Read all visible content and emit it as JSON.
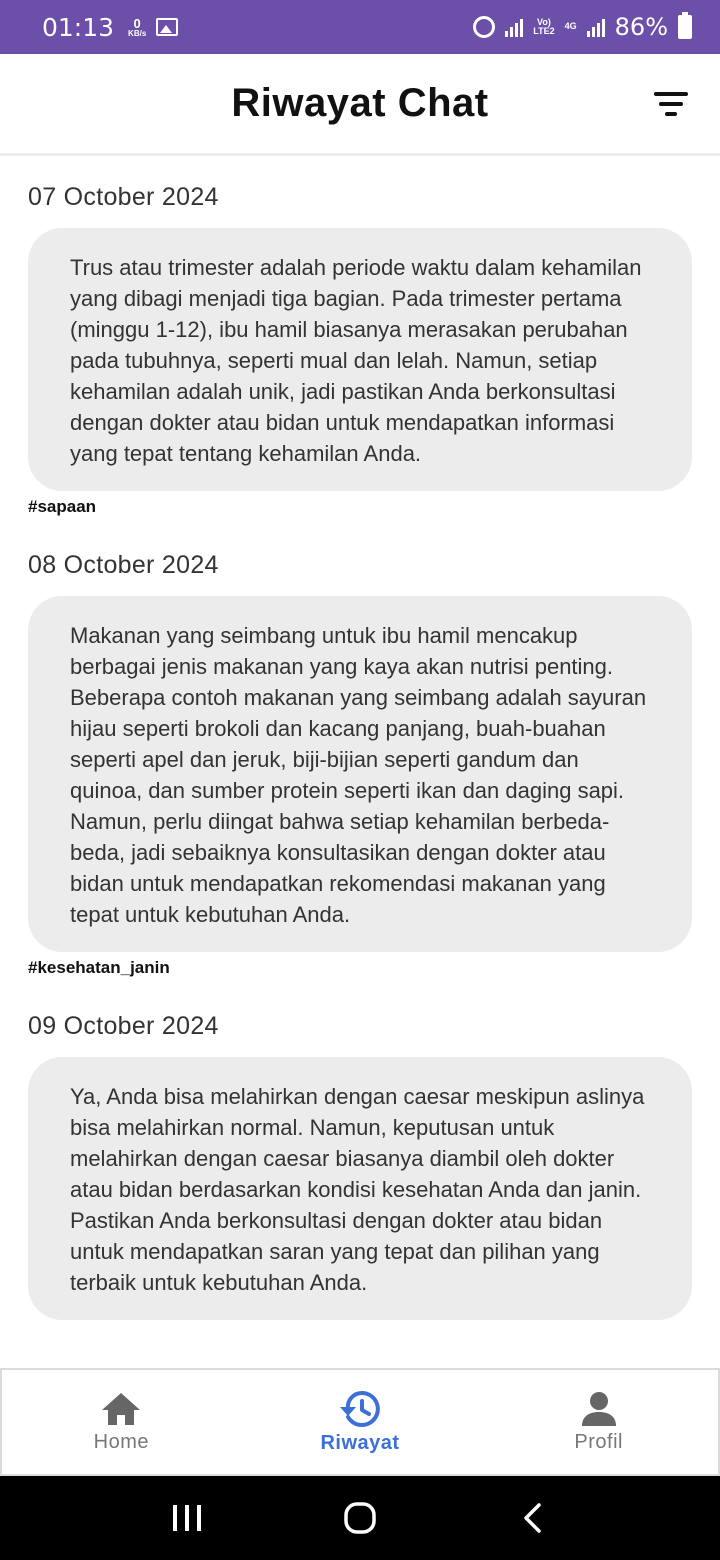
{
  "status_bar": {
    "time": "01:13",
    "speed_value": "0",
    "speed_unit": "KB/s",
    "network_top": "Vo)",
    "network_bottom": "LTE2",
    "network_gen": "4G",
    "battery": "86%"
  },
  "header": {
    "title": "Riwayat Chat",
    "filter_icon": "filter-list-icon"
  },
  "chats": [
    {
      "date": "07 October 2024",
      "message": "Trus atau trimester adalah periode waktu dalam kehamilan yang dibagi menjadi tiga bagian. Pada trimester pertama (minggu 1-12), ibu hamil biasanya merasakan perubahan pada tubuhnya, seperti mual dan lelah. Namun, setiap kehamilan adalah unik, jadi pastikan Anda berkonsultasi dengan dokter atau bidan untuk mendapatkan informasi yang tepat tentang kehamilan Anda.",
      "tag": "#sapaan"
    },
    {
      "date": "08 October 2024",
      "message": "Makanan yang seimbang untuk ibu hamil mencakup berbagai jenis makanan yang kaya akan nutrisi penting. Beberapa contoh makanan yang seimbang adalah sayuran hijau seperti brokoli dan kacang panjang, buah-buahan seperti apel dan jeruk, biji-bijian seperti gandum dan quinoa, dan sumber protein seperti ikan dan daging sapi. Namun, perlu diingat bahwa setiap kehamilan berbeda-beda, jadi sebaiknya konsultasikan dengan dokter atau bidan untuk mendapatkan rekomendasi makanan yang tepat untuk kebutuhan Anda.",
      "tag": "#kesehatan_janin"
    },
    {
      "date": "09 October 2024",
      "message": "Ya, Anda bisa melahirkan dengan caesar meskipun aslinya bisa melahirkan normal. Namun, keputusan untuk melahirkan dengan caesar biasanya diambil oleh dokter atau bidan berdasarkan kondisi kesehatan Anda dan janin. Pastikan Anda berkonsultasi dengan dokter atau bidan untuk mendapatkan saran yang tepat dan pilihan yang terbaik untuk kebutuhan Anda.",
      "tag": ""
    }
  ],
  "bottom_nav": {
    "items": [
      {
        "label": "Home",
        "icon": "home-icon",
        "active": false
      },
      {
        "label": "Riwayat",
        "icon": "history-icon",
        "active": true
      },
      {
        "label": "Profil",
        "icon": "person-icon",
        "active": false
      }
    ]
  },
  "colors": {
    "status_bar": "#6b4fa8",
    "bubble": "#ececec",
    "active_nav": "#3d6fd9",
    "inactive_nav": "#777777"
  }
}
